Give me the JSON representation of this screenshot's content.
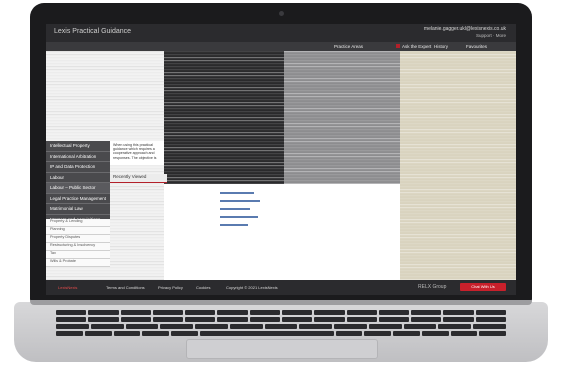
{
  "header": {
    "brand": "Lexis Practical Guidance",
    "user_email": "melanie.gagger.ukl@lexisnexis.co.uk",
    "user_links": "Support · More"
  },
  "nav": {
    "items": [
      "Practice Areas",
      "Ask the Expert",
      "History",
      "Favourites"
    ]
  },
  "sidebar": {
    "items": [
      "Intellectual Property",
      "International Arbitration",
      "IP and Data Protection",
      "Labour",
      "Labour – Public Sector",
      "Legal Practice Management",
      "Matrimonial Law",
      "Mergers and Acquisitions",
      "Other Health and Safety"
    ],
    "lower": [
      "Property & Lending",
      "Planning",
      "Property Disputes",
      "Restructuring & Insolvency",
      "Tax",
      "Wills & Probate"
    ]
  },
  "panel": {
    "text": "When using this practical guidance which requires a cooperative approach and responses. The objective is"
  },
  "recently_viewed": {
    "label": "Recently Viewed"
  },
  "footer": {
    "brand": "LexisNexis",
    "links": [
      "Terms and Conditions",
      "Privacy Policy",
      "Cookies"
    ],
    "copyright": "Copyright © 2021 LexisNexis",
    "group": "RELX Group",
    "chat_button": "Chat With Us"
  },
  "colors": {
    "accent": "#b3202a",
    "dark": "#2b2b2e",
    "link": "#5a7bb0"
  },
  "icons": {
    "menu": "hamburger-icon",
    "search": "search-icon"
  }
}
